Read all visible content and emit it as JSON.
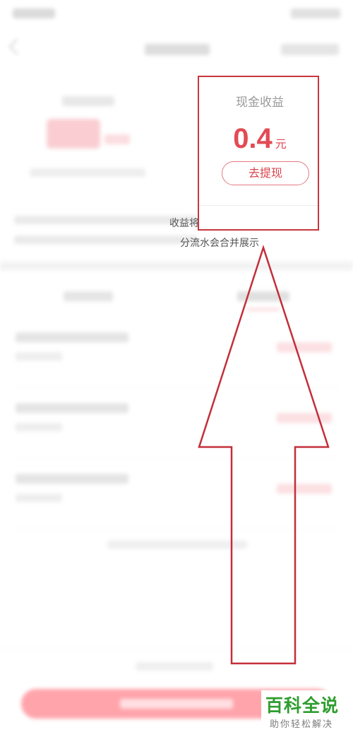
{
  "card": {
    "label": "现金收益",
    "value": "0.4",
    "unit": "元",
    "withdraw_button": "去提现"
  },
  "notice": {
    "line1_visible": "收益将过期清空",
    "line2_visible": "分流水会合并展示"
  },
  "watermark": {
    "title": "百科全说",
    "subtitle": "助你轻松解决"
  },
  "colors": {
    "accent": "#e24a55",
    "highlight_border": "#c8373d",
    "bottom_button": "#ff5a66",
    "watermark_green": "#2f9d2f"
  },
  "icons": {
    "back": "chevron-left-icon",
    "annotation": "up-arrow-icon"
  }
}
